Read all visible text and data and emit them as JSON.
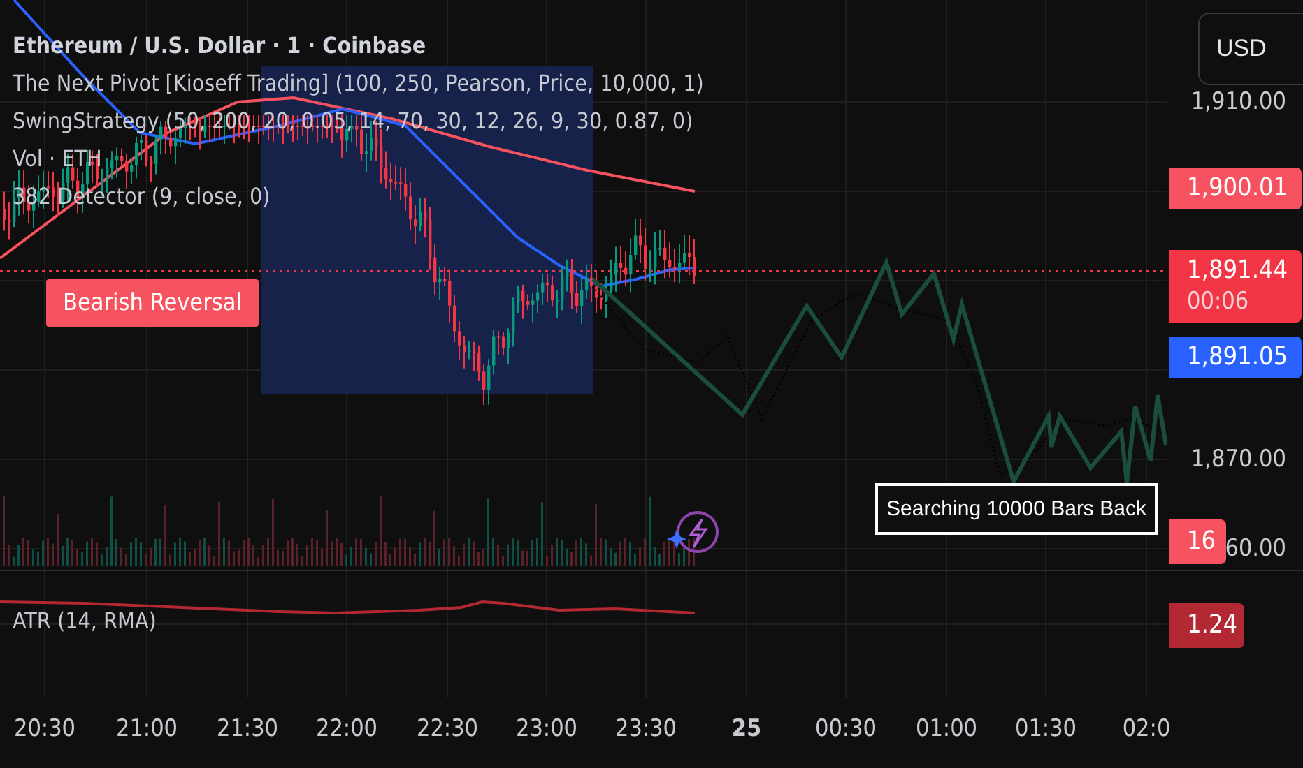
{
  "legend": {
    "title": "Ethereum / U.S. Dollar · 1 · Coinbase",
    "indicators": [
      "The Next Pivot [Kioseff Trading] (100, 250, Pearson, Price, 10,000, 1)",
      "SwingStrategy (50, 200, 20, 0.05, 14, 70, 30, 12, 26, 9, 30, 0.87, 0)",
      "Vol · ETH",
      "382 Detector (9, close, 0)"
    ]
  },
  "signal_label": "Bearish Reversal",
  "search_note": "Searching 10000 Bars Back",
  "currency_button": "USD",
  "price_axis": [
    {
      "text": "1,910.00"
    },
    {
      "text": "1,870.00"
    },
    {
      "text": "60.00"
    }
  ],
  "price_tags": [
    {
      "text": "1,900.01",
      "color": "#f7525f"
    },
    {
      "text": "1,891.44",
      "sub": "00:06",
      "color": "#f23645"
    },
    {
      "text": "1,891.05",
      "color": "#2962ff"
    }
  ],
  "volume_tag": {
    "text": "16",
    "color": "#f7525f"
  },
  "atr": {
    "label": "ATR (14, RMA)",
    "value": "1.24",
    "color": "#b22833"
  },
  "time_axis": [
    {
      "text": "20:30",
      "bold": false
    },
    {
      "text": "21:00",
      "bold": false
    },
    {
      "text": "21:30",
      "bold": false
    },
    {
      "text": "22:00",
      "bold": false
    },
    {
      "text": "22:30",
      "bold": false
    },
    {
      "text": "23:00",
      "bold": false
    },
    {
      "text": "23:30",
      "bold": false
    },
    {
      "text": "25",
      "bold": true
    },
    {
      "text": "00:30",
      "bold": false
    },
    {
      "text": "01:00",
      "bold": false
    },
    {
      "text": "01:30",
      "bold": false
    },
    {
      "text": "02:0",
      "bold": false
    }
  ]
}
